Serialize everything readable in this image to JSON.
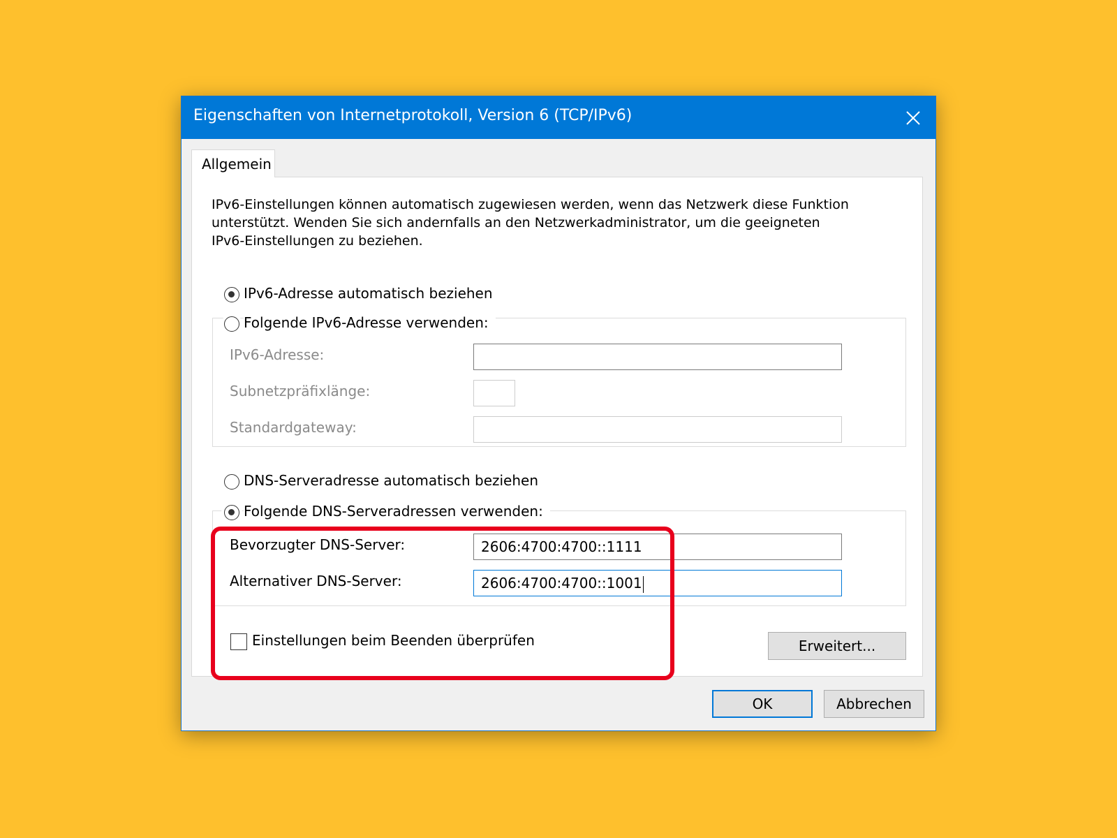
{
  "dialog": {
    "title": "Eigenschaften von Internetprotokoll, Version 6 (TCP/IPv6)",
    "close_icon": "close-icon"
  },
  "tabs": [
    {
      "label": "Allgemein",
      "active": true
    }
  ],
  "description": [
    "IPv6-Einstellungen können automatisch zugewiesen werden, wenn das Netzwerk diese Funktion",
    "unterstützt. Wenden Sie sich andernfalls an den Netzwerkadministrator, um die geeigneten",
    "IPv6-Einstellungen zu beziehen."
  ],
  "ip_options": {
    "auto_label": "IPv6-Adresse automatisch beziehen",
    "auto_checked": true,
    "manual_label": "Folgende IPv6-Adresse verwenden:",
    "manual_checked": false
  },
  "ip_fields": {
    "address_label": "IPv6-Adresse:",
    "address_value": "",
    "prefix_label": "Subnetzpräfixlänge:",
    "prefix_value": "",
    "gateway_label": "Standardgateway:",
    "gateway_value": ""
  },
  "dns_options": {
    "auto_label": "DNS-Serveradresse automatisch beziehen",
    "auto_checked": false,
    "manual_label": "Folgende DNS-Serveradressen verwenden:",
    "manual_checked": true
  },
  "dns_fields": {
    "preferred_label": "Bevorzugter DNS-Server:",
    "preferred_value": "2606:4700:4700::1111",
    "alternate_label": "Alternativer DNS-Server:",
    "alternate_value": "2606:4700:4700::1001"
  },
  "validate_checkbox": {
    "label": "Einstellungen beim Beenden überprüfen",
    "checked": false
  },
  "buttons": {
    "advanced": "Erweitert...",
    "ok": "OK",
    "cancel": "Abbrechen"
  },
  "colors": {
    "background": "#FEC02D",
    "titlebar": "#0078D7",
    "highlight": "#E8001C"
  }
}
